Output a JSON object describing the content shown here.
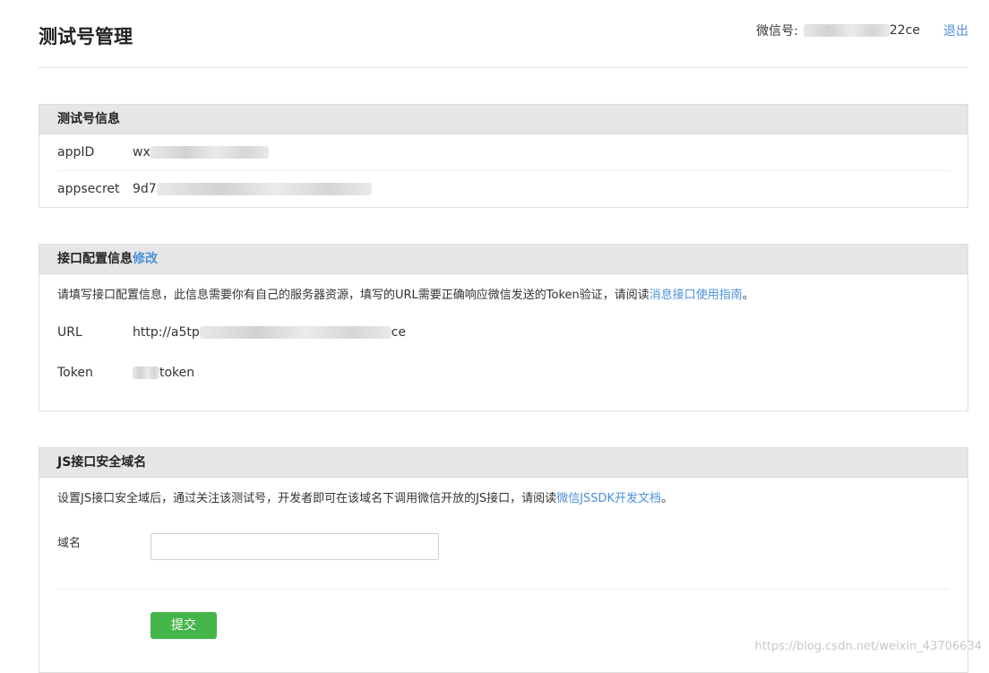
{
  "header": {
    "title": "测试号管理",
    "wechat_label": "微信号:",
    "wechat_suffix": "22ce",
    "logout": "退出"
  },
  "test_info": {
    "heading": "测试号信息",
    "appid_label": "appID",
    "appid_prefix": "wx",
    "appsecret_label": "appsecret",
    "appsecret_prefix": "9d7"
  },
  "interface_config": {
    "heading": "接口配置信息",
    "edit_link": "修改",
    "description": "请填写接口配置信息，此信息需要你有自己的服务器资源，填写的URL需要正确响应微信发送的Token验证，请阅读",
    "guide_link": "消息接口使用指南",
    "period": "。",
    "url_label": "URL",
    "url_prefix": "http://a5tp",
    "url_suffix": "ce",
    "token_label": "Token",
    "token_suffix": "token"
  },
  "js_domain": {
    "heading": "JS接口安全域名",
    "description": "设置JS接口安全域后，通过关注该测试号，开发者即可在该域名下调用微信开放的JS接口，请阅读",
    "doc_link": "微信JSSDK开发文档",
    "period": "。",
    "domain_label": "域名",
    "domain_value": "",
    "submit": "提交"
  },
  "watermark": "https://blog.csdn.net/weixin_43706634",
  "colors": {
    "accent_link": "#4a90d9",
    "submit_green": "#44b549",
    "panel_header_bg": "#e6e6e6"
  }
}
